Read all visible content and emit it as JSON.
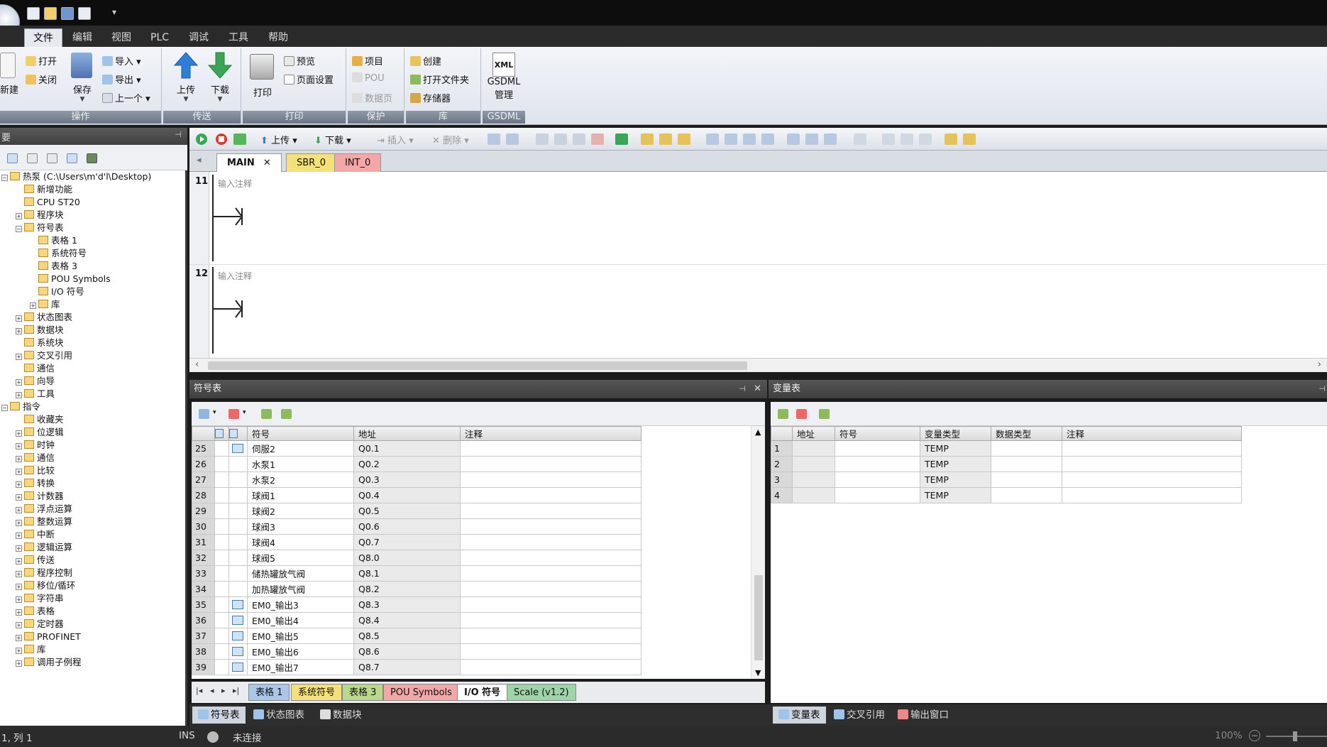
{
  "menu": {
    "tabs": [
      "文件",
      "编辑",
      "视图",
      "PLC",
      "调试",
      "工具",
      "帮助"
    ]
  },
  "ribbon": {
    "ops": {
      "new": "新建",
      "open": "打开",
      "close": "关闭",
      "save": "保存",
      "import": "导入",
      "export": "导出",
      "prev": "上一个",
      "label": "操作"
    },
    "transfer": {
      "upload": "上传",
      "download": "下载",
      "label": "传送"
    },
    "print": {
      "print": "打印",
      "preview": "预览",
      "page_setup": "页面设置",
      "label": "打印"
    },
    "protect": {
      "project": "项目",
      "pou": "POU",
      "data_page": "数据页",
      "label": "保护"
    },
    "lib": {
      "create": "创建",
      "open_folder": "打开文件夹",
      "memory": "存储器",
      "label": "库"
    },
    "gsdml": {
      "xml": "XML",
      "line1": "GSDML",
      "line2": "管理",
      "label": "GSDML"
    }
  },
  "left": {
    "header": "要",
    "tree": [
      {
        "text": "热泵 (C:\\Users\\m'd'l\\Desktop)",
        "depth": 0,
        "exp": "-"
      },
      {
        "text": "新增功能",
        "depth": 1,
        "exp": ""
      },
      {
        "text": "CPU ST20",
        "depth": 1,
        "exp": ""
      },
      {
        "text": "程序块",
        "depth": 1,
        "exp": "+"
      },
      {
        "text": "符号表",
        "depth": 1,
        "exp": "-"
      },
      {
        "text": "表格 1",
        "depth": 2,
        "exp": ""
      },
      {
        "text": "系统符号",
        "depth": 2,
        "exp": ""
      },
      {
        "text": "表格 3",
        "depth": 2,
        "exp": ""
      },
      {
        "text": "POU Symbols",
        "depth": 2,
        "exp": ""
      },
      {
        "text": "I/O 符号",
        "depth": 2,
        "exp": ""
      },
      {
        "text": "库",
        "depth": 2,
        "exp": "+"
      },
      {
        "text": "状态图表",
        "depth": 1,
        "exp": "+"
      },
      {
        "text": "数据块",
        "depth": 1,
        "exp": "+"
      },
      {
        "text": "系统块",
        "depth": 1,
        "exp": ""
      },
      {
        "text": "交叉引用",
        "depth": 1,
        "exp": "+"
      },
      {
        "text": "通信",
        "depth": 1,
        "exp": ""
      },
      {
        "text": "向导",
        "depth": 1,
        "exp": "+"
      },
      {
        "text": "工具",
        "depth": 1,
        "exp": "+"
      },
      {
        "text": "指令",
        "depth": 0,
        "exp": "-"
      },
      {
        "text": "收藏夹",
        "depth": 1,
        "exp": ""
      },
      {
        "text": "位逻辑",
        "depth": 1,
        "exp": "+"
      },
      {
        "text": "时钟",
        "depth": 1,
        "exp": "+"
      },
      {
        "text": "通信",
        "depth": 1,
        "exp": "+"
      },
      {
        "text": "比较",
        "depth": 1,
        "exp": "+"
      },
      {
        "text": "转换",
        "depth": 1,
        "exp": "+"
      },
      {
        "text": "计数器",
        "depth": 1,
        "exp": "+"
      },
      {
        "text": "浮点运算",
        "depth": 1,
        "exp": "+"
      },
      {
        "text": "整数运算",
        "depth": 1,
        "exp": "+"
      },
      {
        "text": "中断",
        "depth": 1,
        "exp": "+"
      },
      {
        "text": "逻辑运算",
        "depth": 1,
        "exp": "+"
      },
      {
        "text": "传送",
        "depth": 1,
        "exp": "+"
      },
      {
        "text": "程序控制",
        "depth": 1,
        "exp": "+"
      },
      {
        "text": "移位/循环",
        "depth": 1,
        "exp": "+"
      },
      {
        "text": "字符串",
        "depth": 1,
        "exp": "+"
      },
      {
        "text": "表格",
        "depth": 1,
        "exp": "+"
      },
      {
        "text": "定时器",
        "depth": 1,
        "exp": "+"
      },
      {
        "text": "PROFINET",
        "depth": 1,
        "exp": "+"
      },
      {
        "text": "库",
        "depth": 1,
        "exp": "+"
      },
      {
        "text": "调用子例程",
        "depth": 1,
        "exp": "+"
      }
    ]
  },
  "editor": {
    "toolbar": {
      "upload": "上传",
      "download": "下载",
      "insert": "插入",
      "delete": "删除"
    },
    "tabs": [
      "MAIN",
      "SBR_0",
      "INT_0"
    ],
    "networks": [
      {
        "num": "11",
        "comment": "输入注释"
      },
      {
        "num": "12",
        "comment": "输入注释"
      }
    ]
  },
  "symtable": {
    "title": "符号表",
    "columns": [
      "符号",
      "地址",
      "注释"
    ],
    "rows": [
      {
        "n": "25",
        "icon": true,
        "sym": "伺服2",
        "addr": "Q0.1"
      },
      {
        "n": "26",
        "icon": false,
        "sym": "水泵1",
        "addr": "Q0.2"
      },
      {
        "n": "27",
        "icon": false,
        "sym": "水泵2",
        "addr": "Q0.3"
      },
      {
        "n": "28",
        "icon": false,
        "sym": "球阀1",
        "addr": "Q0.4"
      },
      {
        "n": "29",
        "icon": false,
        "sym": "球阀2",
        "addr": "Q0.5"
      },
      {
        "n": "30",
        "icon": false,
        "sym": "球阀3",
        "addr": "Q0.6"
      },
      {
        "n": "31",
        "icon": false,
        "sym": "球阀4",
        "addr": "Q0.7"
      },
      {
        "n": "32",
        "icon": false,
        "sym": "球阀5",
        "addr": "Q8.0"
      },
      {
        "n": "33",
        "icon": false,
        "sym": "储热罐放气阀",
        "addr": "Q8.1"
      },
      {
        "n": "34",
        "icon": false,
        "sym": "加热罐放气阀",
        "addr": "Q8.2"
      },
      {
        "n": "35",
        "icon": true,
        "sym": "EM0_输出3",
        "addr": "Q8.3"
      },
      {
        "n": "36",
        "icon": true,
        "sym": "EM0_输出4",
        "addr": "Q8.4"
      },
      {
        "n": "37",
        "icon": true,
        "sym": "EM0_输出5",
        "addr": "Q8.5"
      },
      {
        "n": "38",
        "icon": true,
        "sym": "EM0_输出6",
        "addr": "Q8.6"
      },
      {
        "n": "39",
        "icon": true,
        "sym": "EM0_输出7",
        "addr": "Q8.7"
      }
    ],
    "sheet_tabs": [
      "表格 1",
      "系统符号",
      "表格 3",
      "POU Symbols",
      "I/O 符号",
      "Scale (v1.2)"
    ]
  },
  "vartable": {
    "title": "变量表",
    "columns": [
      "地址",
      "符号",
      "变量类型",
      "数据类型",
      "注释"
    ],
    "rows": [
      {
        "n": "1",
        "type": "TEMP"
      },
      {
        "n": "2",
        "type": "TEMP"
      },
      {
        "n": "3",
        "type": "TEMP"
      },
      {
        "n": "4",
        "type": "TEMP"
      }
    ]
  },
  "bottom_nav": [
    "符号表",
    "状态图表",
    "数据块",
    "变量表",
    "交叉引用",
    "输出窗口"
  ],
  "status": {
    "pos": "1, 列 1",
    "mode": "INS",
    "conn": "未连接",
    "zoom": "100%"
  },
  "colors": {
    "sbr_tab": "#f5e07a",
    "int_tab": "#f4a7a7",
    "accent_green": "#3aa655",
    "accent_blue": "#2f7fd8"
  }
}
